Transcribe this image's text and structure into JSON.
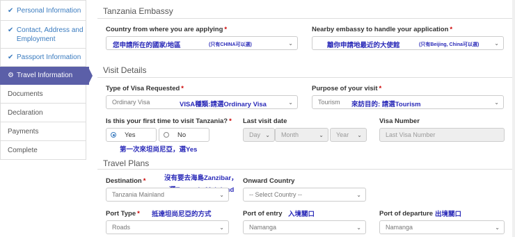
{
  "sidebar": {
    "items": [
      {
        "label": "Personal Information",
        "state": "done"
      },
      {
        "label": "Contact, Address and Employment",
        "state": "done"
      },
      {
        "label": "Passport Information",
        "state": "done"
      },
      {
        "label": "Travel Information",
        "state": "active"
      },
      {
        "label": "Documents",
        "state": ""
      },
      {
        "label": "Declaration",
        "state": ""
      },
      {
        "label": "Payments",
        "state": ""
      },
      {
        "label": "Complete",
        "state": ""
      }
    ]
  },
  "embassy": {
    "title": "Tanzania Embassy",
    "country_label": "Country from where you are applying",
    "country_value": "您申請所在的國家/地區",
    "country_note": "(只有CHINA可以選)",
    "nearby_label": "Nearby embassy to handle your application",
    "nearby_value": "離你申請地最近的大使館",
    "nearby_note": "(只有Beijing, China可以選)"
  },
  "visit": {
    "title": "Visit Details",
    "type_label": "Type of Visa Requested",
    "type_value": "Ordinary Visa",
    "type_note": "VISA種類:請選Ordinary Visa",
    "purpose_label": "Purpose of your visit",
    "purpose_value": "Tourism",
    "purpose_note": "來訪目的: 請選Tourism",
    "first_label": "Is this your first time to visit Tanzania?",
    "yes": "Yes",
    "no": "No",
    "first_note": "第一次來坦尚尼亞，選Yes",
    "last_label": "Last visit date",
    "day": "Day",
    "month": "Month",
    "year": "Year",
    "visa_num_label": "Visa Number",
    "visa_num_placeholder": "Last Visa Number"
  },
  "plans": {
    "title": "Travel Plans",
    "dest_label": "Destination",
    "dest_value": "Tanzania Mainland",
    "dest_note1": "沒有要去海島Zanzibar，",
    "dest_note2": "選Tanzania Mainland",
    "onward_label": "Onward Country",
    "onward_value": "-- Select Country --",
    "port_type_label": "Port Type",
    "port_type_value": "Roads",
    "port_type_note": "抵達坦尚尼亞的方式",
    "entry_label": "Port of entry",
    "entry_value": "Namanga",
    "entry_note": "入境關口",
    "departure_label": "Port of departure",
    "departure_value": "Namanga",
    "departure_note": "出境關口"
  },
  "required_mark": "*",
  "icons": {
    "check": "check-icon",
    "spinner": "spinner-icon",
    "caret": "caret-down-icon"
  }
}
